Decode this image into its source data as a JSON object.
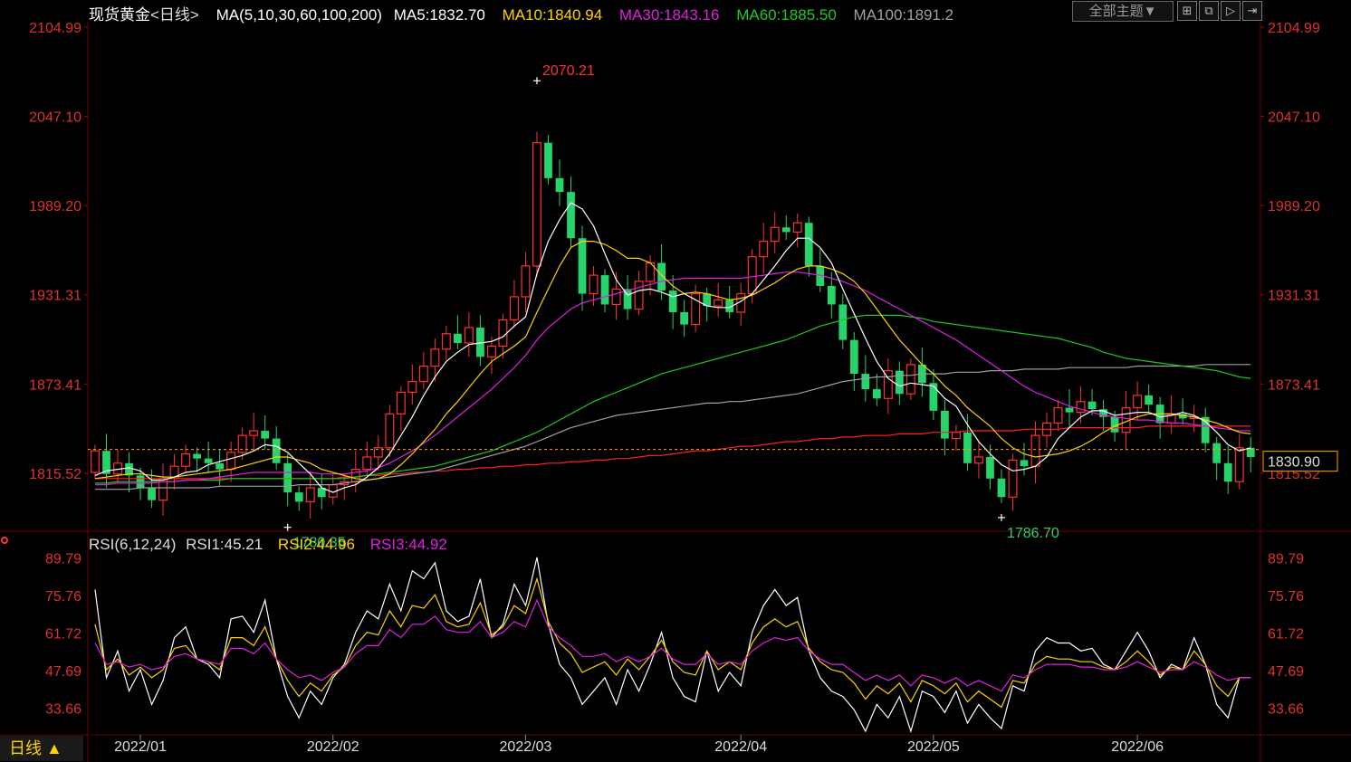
{
  "header": {
    "symbol": "现货黄金",
    "period_tag": "<日线>",
    "ma_params": "MA(5,10,30,60,100,200)",
    "ma5": "MA5:1832.70",
    "ma10": "MA10:1840.94",
    "ma30": "MA30:1843.16",
    "ma60": "MA60:1885.50",
    "ma100": "MA100:1891.2",
    "theme_button": "全部主题▼"
  },
  "rsi_header": {
    "params": "RSI(6,12,24)",
    "rsi1": "RSI1:45.21",
    "rsi2": "RSI2:44.96",
    "rsi3": "RSI3:44.92"
  },
  "period_button": "日线 ▲",
  "colors": {
    "up": "#ff3030",
    "down": "#27d36a",
    "ma5": "#ffffff",
    "ma10": "#ffd200",
    "ma30": "#e020e0",
    "ma60": "#1fc81f",
    "ma100": "#a0a0a0",
    "ma200": "#ff2020",
    "price_axis": "#e03030",
    "grid": "#5a0000"
  },
  "chart_data": [
    {
      "type": "candlestick",
      "title": "现货黄金",
      "y_ticks": [
        "2104.99",
        "2047.10",
        "1989.20",
        "1931.31",
        "1873.41",
        "1815.52"
      ],
      "ylim": [
        1779,
        2105
      ],
      "x_ticks": [
        "2022/01",
        "2022/02",
        "2022/03",
        "2022/04",
        "2022/05",
        "2022/06"
      ],
      "x_tick_index": [
        4,
        21,
        38,
        57,
        74,
        92
      ],
      "last_price": "1830.90",
      "annotations": [
        {
          "label": "2070.21",
          "index": 39,
          "value": 2070.21,
          "kind": "high"
        },
        {
          "label": "1780.35",
          "index": 17,
          "value": 1780.35,
          "kind": "low"
        },
        {
          "label": "1786.70",
          "index": 80,
          "value": 1786.7,
          "kind": "low"
        }
      ],
      "close": [
        1830,
        1815,
        1822,
        1814,
        1806,
        1798,
        1812,
        1820,
        1828,
        1825,
        1822,
        1818,
        1829,
        1840,
        1843,
        1838,
        1822,
        1803,
        1797,
        1806,
        1800,
        1808,
        1810,
        1818,
        1826,
        1832,
        1854,
        1868,
        1875,
        1885,
        1896,
        1906,
        1900,
        1910,
        1891,
        1898,
        1915,
        1930,
        1950,
        2030,
        2007,
        1998,
        1968,
        1932,
        1944,
        1925,
        1935,
        1922,
        1940,
        1952,
        1934,
        1920,
        1912,
        1932,
        1924,
        1928,
        1920,
        1932,
        1956,
        1966,
        1975,
        1972,
        1978,
        1950,
        1937,
        1925,
        1902,
        1880,
        1870,
        1864,
        1882,
        1867,
        1886,
        1874,
        1856,
        1838,
        1842,
        1822,
        1826,
        1812,
        1800,
        1824,
        1820,
        1840,
        1848,
        1858,
        1855,
        1862,
        1857,
        1852,
        1842,
        1858,
        1866,
        1860,
        1848,
        1854,
        1851,
        1852,
        1835,
        1822,
        1810,
        1832,
        1826
      ],
      "ma5": [
        1814,
        1817,
        1818,
        1819,
        1817,
        1811,
        1811,
        1813,
        1816,
        1817,
        1821,
        1823,
        1825,
        1827,
        1830,
        1834,
        1833,
        1829,
        1822,
        1815,
        1806,
        1803,
        1806,
        1808,
        1813,
        1819,
        1828,
        1840,
        1852,
        1866,
        1878,
        1888,
        1894,
        1899,
        1900,
        1901,
        1904,
        1911,
        1917,
        1945,
        1966,
        1980,
        1991,
        1987,
        1976,
        1958,
        1941,
        1931,
        1934,
        1935,
        1933,
        1930,
        1932,
        1928,
        1924,
        1923,
        1923,
        1927,
        1932,
        1941,
        1950,
        1960,
        1968,
        1968,
        1962,
        1952,
        1935,
        1919,
        1903,
        1888,
        1877,
        1872,
        1874,
        1873,
        1872,
        1864,
        1859,
        1847,
        1836,
        1828,
        1821,
        1817,
        1818,
        1820,
        1826,
        1838,
        1845,
        1852,
        1856,
        1856,
        1853,
        1854,
        1855,
        1855,
        1852,
        1853,
        1855,
        1853,
        1849,
        1842,
        1834,
        1830,
        1832
      ],
      "ma10": [
        1812,
        1813,
        1814,
        1815,
        1815,
        1814,
        1813,
        1813,
        1814,
        1815,
        1816,
        1817,
        1818,
        1820,
        1822,
        1824,
        1826,
        1826,
        1824,
        1822,
        1818,
        1816,
        1814,
        1812,
        1811,
        1812,
        1815,
        1821,
        1828,
        1836,
        1844,
        1854,
        1862,
        1871,
        1880,
        1888,
        1893,
        1898,
        1904,
        1920,
        1935,
        1950,
        1962,
        1966,
        1966,
        1964,
        1960,
        1955,
        1955,
        1952,
        1944,
        1937,
        1932,
        1933,
        1932,
        1930,
        1928,
        1929,
        1931,
        1935,
        1939,
        1944,
        1948,
        1950,
        1950,
        1948,
        1945,
        1940,
        1932,
        1922,
        1912,
        1902,
        1894,
        1886,
        1880,
        1872,
        1866,
        1858,
        1852,
        1846,
        1838,
        1832,
        1828,
        1826,
        1827,
        1828,
        1830,
        1833,
        1837,
        1842,
        1846,
        1849,
        1852,
        1854,
        1854,
        1854,
        1853,
        1852,
        1850,
        1848,
        1845,
        1842,
        1841
      ],
      "ma30": [
        1808,
        1808,
        1809,
        1809,
        1809,
        1809,
        1810,
        1810,
        1811,
        1811,
        1812,
        1813,
        1814,
        1815,
        1816,
        1816,
        1816,
        1816,
        1816,
        1816,
        1815,
        1815,
        1815,
        1816,
        1817,
        1819,
        1822,
        1826,
        1830,
        1835,
        1840,
        1846,
        1852,
        1858,
        1864,
        1870,
        1877,
        1884,
        1892,
        1902,
        1910,
        1916,
        1922,
        1926,
        1928,
        1930,
        1932,
        1934,
        1936,
        1938,
        1940,
        1941,
        1942,
        1942,
        1942,
        1942,
        1942,
        1942,
        1943,
        1944,
        1945,
        1946,
        1946,
        1945,
        1944,
        1942,
        1940,
        1937,
        1934,
        1930,
        1926,
        1922,
        1918,
        1914,
        1910,
        1906,
        1902,
        1897,
        1892,
        1887,
        1882,
        1877,
        1872,
        1868,
        1865,
        1862,
        1859,
        1857,
        1855,
        1853,
        1852,
        1851,
        1850,
        1850,
        1849,
        1848,
        1848,
        1847,
        1846,
        1845,
        1844,
        1843,
        1843
      ],
      "ma60": [
        1809,
        1809,
        1810,
        1810,
        1810,
        1810,
        1810,
        1810,
        1811,
        1811,
        1811,
        1811,
        1812,
        1812,
        1812,
        1812,
        1812,
        1812,
        1812,
        1812,
        1812,
        1812,
        1812,
        1813,
        1814,
        1815,
        1816,
        1817,
        1818,
        1819,
        1820,
        1822,
        1824,
        1826,
        1828,
        1830,
        1833,
        1836,
        1839,
        1842,
        1846,
        1850,
        1854,
        1858,
        1862,
        1865,
        1868,
        1871,
        1874,
        1877,
        1880,
        1882,
        1884,
        1886,
        1888,
        1890,
        1892,
        1894,
        1896,
        1898,
        1900,
        1902,
        1905,
        1908,
        1911,
        1913,
        1915,
        1917,
        1918,
        1918,
        1918,
        1918,
        1917,
        1916,
        1914,
        1913,
        1912,
        1911,
        1910,
        1909,
        1908,
        1907,
        1906,
        1905,
        1904,
        1903,
        1901,
        1899,
        1897,
        1894,
        1892,
        1890,
        1889,
        1888,
        1887,
        1886,
        1885,
        1884,
        1883,
        1882,
        1880,
        1878,
        1877
      ],
      "ma100": [
        1805,
        1805,
        1805,
        1805,
        1806,
        1806,
        1806,
        1806,
        1806,
        1806,
        1806,
        1807,
        1807,
        1807,
        1807,
        1807,
        1807,
        1807,
        1808,
        1808,
        1808,
        1808,
        1809,
        1810,
        1811,
        1812,
        1813,
        1814,
        1815,
        1816,
        1817,
        1819,
        1821,
        1823,
        1825,
        1827,
        1829,
        1831,
        1833,
        1836,
        1839,
        1842,
        1845,
        1847,
        1849,
        1851,
        1853,
        1854,
        1855,
        1856,
        1857,
        1858,
        1859,
        1860,
        1861,
        1861,
        1862,
        1862,
        1863,
        1864,
        1865,
        1866,
        1867,
        1869,
        1871,
        1873,
        1875,
        1876,
        1877,
        1878,
        1878,
        1879,
        1879,
        1880,
        1880,
        1880,
        1881,
        1881,
        1881,
        1882,
        1882,
        1882,
        1883,
        1883,
        1883,
        1883,
        1884,
        1884,
        1884,
        1884,
        1884,
        1884,
        1885,
        1885,
        1885,
        1885,
        1885,
        1885,
        1886,
        1886,
        1886,
        1886,
        1886
      ],
      "ma200": [
        1812,
        1812,
        1812,
        1812,
        1812,
        1812,
        1812,
        1812,
        1812,
        1812,
        1812,
        1812,
        1812,
        1812,
        1812,
        1812,
        1812,
        1812,
        1812,
        1812,
        1812,
        1812,
        1813,
        1813,
        1814,
        1814,
        1815,
        1815,
        1816,
        1816,
        1817,
        1817,
        1818,
        1818,
        1819,
        1819,
        1820,
        1820,
        1821,
        1821,
        1822,
        1822,
        1823,
        1823,
        1824,
        1824,
        1825,
        1825,
        1826,
        1827,
        1827,
        1828,
        1829,
        1830,
        1830,
        1831,
        1832,
        1833,
        1833,
        1834,
        1835,
        1836,
        1836,
        1837,
        1838,
        1838,
        1839,
        1839,
        1840,
        1840,
        1840,
        1841,
        1841,
        1841,
        1842,
        1842,
        1842,
        1843,
        1843,
        1843,
        1843,
        1843,
        1844,
        1844,
        1844,
        1844,
        1845,
        1845,
        1845,
        1845,
        1845,
        1845,
        1845,
        1846,
        1846,
        1846,
        1846,
        1846,
        1846,
        1846,
        1846,
        1846,
        1846
      ]
    },
    {
      "type": "line",
      "title": "RSI(6,12,24)",
      "y_ticks": [
        "89.79",
        "75.76",
        "61.72",
        "47.69",
        "33.66"
      ],
      "ylim": [
        25,
        92
      ],
      "series": [
        {
          "name": "RSI1",
          "values": [
            78,
            45,
            55,
            40,
            48,
            35,
            44,
            60,
            64,
            52,
            50,
            45,
            67,
            68,
            62,
            74,
            52,
            38,
            30,
            40,
            35,
            45,
            50,
            62,
            70,
            67,
            80,
            70,
            85,
            82,
            88,
            70,
            66,
            68,
            82,
            60,
            65,
            80,
            72,
            90,
            65,
            50,
            45,
            35,
            40,
            45,
            35,
            48,
            40,
            50,
            62,
            45,
            38,
            36,
            55,
            40,
            47,
            42,
            62,
            72,
            78,
            72,
            75,
            55,
            45,
            40,
            38,
            33,
            25,
            35,
            30,
            38,
            25,
            40,
            38,
            32,
            40,
            28,
            35,
            30,
            26,
            42,
            40,
            55,
            60,
            58,
            58,
            55,
            56,
            50,
            48,
            55,
            62,
            55,
            45,
            50,
            48,
            60,
            50,
            35,
            30,
            45,
            45
          ]
        },
        {
          "name": "RSI2",
          "values": [
            65,
            48,
            52,
            46,
            49,
            45,
            48,
            56,
            57,
            52,
            51,
            48,
            60,
            60,
            57,
            64,
            52,
            44,
            38,
            43,
            40,
            46,
            49,
            57,
            62,
            61,
            70,
            64,
            72,
            71,
            76,
            66,
            64,
            65,
            73,
            61,
            64,
            72,
            69,
            82,
            66,
            58,
            54,
            47,
            49,
            51,
            46,
            52,
            48,
            53,
            59,
            51,
            47,
            46,
            55,
            48,
            51,
            48,
            58,
            64,
            67,
            64,
            66,
            56,
            51,
            48,
            47,
            43,
            37,
            42,
            39,
            43,
            36,
            44,
            42,
            39,
            43,
            36,
            40,
            37,
            34,
            44,
            43,
            50,
            53,
            52,
            52,
            51,
            51,
            49,
            48,
            51,
            55,
            51,
            46,
            49,
            48,
            55,
            50,
            42,
            38,
            45,
            45
          ]
        },
        {
          "name": "RSI3",
          "values": [
            58,
            50,
            51,
            49,
            50,
            48,
            49,
            53,
            54,
            52,
            51,
            50,
            56,
            56,
            54,
            58,
            52,
            48,
            45,
            46,
            44,
            47,
            49,
            54,
            57,
            57,
            63,
            60,
            65,
            65,
            68,
            63,
            62,
            62,
            66,
            60,
            62,
            66,
            64,
            74,
            64,
            60,
            57,
            53,
            53,
            54,
            51,
            53,
            51,
            53,
            56,
            52,
            50,
            50,
            54,
            50,
            51,
            50,
            55,
            58,
            60,
            59,
            60,
            55,
            52,
            50,
            50,
            47,
            44,
            46,
            44,
            46,
            42,
            46,
            45,
            43,
            45,
            42,
            44,
            42,
            40,
            46,
            45,
            48,
            50,
            50,
            50,
            49,
            49,
            48,
            48,
            49,
            51,
            49,
            47,
            48,
            48,
            51,
            49,
            46,
            44,
            45,
            45
          ]
        }
      ]
    }
  ]
}
